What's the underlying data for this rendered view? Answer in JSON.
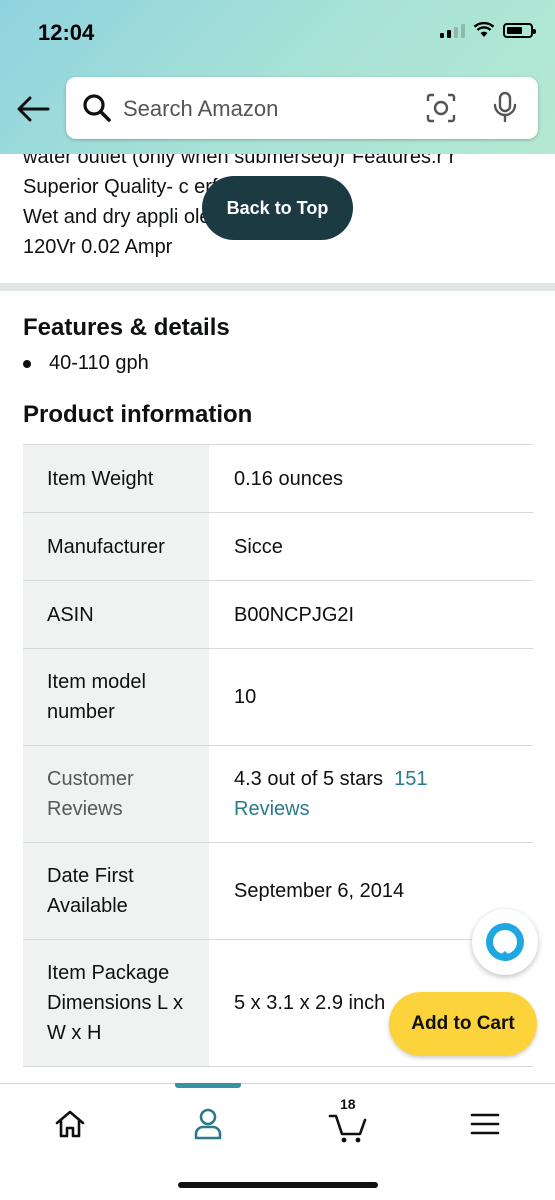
{
  "status_bar": {
    "time": "12:04"
  },
  "search": {
    "placeholder": "Search Amazon"
  },
  "description": {
    "lines": [
      "water outlet (only when submersed)r Features:r r",
      "Superior Quality- c                erful, and quietr",
      "Wet and dry appli                   olerr 2.8Wr",
      "120Vr 0.02 Ampr"
    ]
  },
  "back_to_top": {
    "label": "Back to Top"
  },
  "features": {
    "title": "Features & details",
    "bullets": [
      "40-110 gph"
    ]
  },
  "product_info": {
    "title": "Product information",
    "rows": [
      {
        "key": "Item Weight",
        "value": "0.16 ounces"
      },
      {
        "key": "Manufacturer",
        "value": "Sicce"
      },
      {
        "key": "ASIN",
        "value": "B00NCPJG2I"
      },
      {
        "key": "Item model number",
        "value": "10"
      },
      {
        "key": "Customer Reviews",
        "value": "4.3 out of 5 stars",
        "link": "151 Reviews"
      },
      {
        "key": "Date First Available",
        "value": "September 6, 2014"
      },
      {
        "key": "Item Package Dimensions L x W x H",
        "value": "5 x 3.1 x 2.9 inch"
      }
    ]
  },
  "add_to_cart": {
    "label": "Add to Cart"
  },
  "nav": {
    "cart_count": "18",
    "items": [
      "home-icon",
      "account-icon",
      "cart-icon",
      "menu-icon"
    ]
  },
  "colors": {
    "accent": "#2a7a8c",
    "back_to_top_bg": "#1c3a42",
    "add_to_cart_bg": "#fcd33a"
  }
}
